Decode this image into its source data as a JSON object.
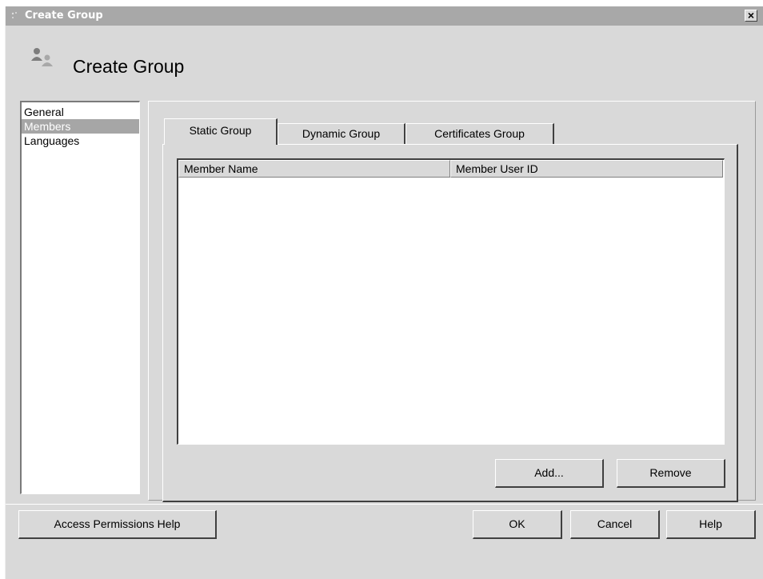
{
  "window": {
    "title": "Create Group",
    "close_label": "×"
  },
  "header": {
    "title": "Create Group",
    "icon": "group-users-icon"
  },
  "nav": {
    "items": [
      {
        "label": "General",
        "selected": false
      },
      {
        "label": "Members",
        "selected": true
      },
      {
        "label": "Languages",
        "selected": false
      }
    ]
  },
  "tabs": [
    {
      "label": "Static Group",
      "active": true
    },
    {
      "label": "Dynamic Group",
      "active": false
    },
    {
      "label": "Certificates Group",
      "active": false
    }
  ],
  "members_table": {
    "columns": [
      "Member Name",
      "Member User ID"
    ],
    "rows": []
  },
  "tab_buttons": {
    "add": "Add...",
    "remove": "Remove"
  },
  "footer": {
    "access_help": "Access Permissions Help",
    "ok": "OK",
    "cancel": "Cancel",
    "help": "Help"
  }
}
